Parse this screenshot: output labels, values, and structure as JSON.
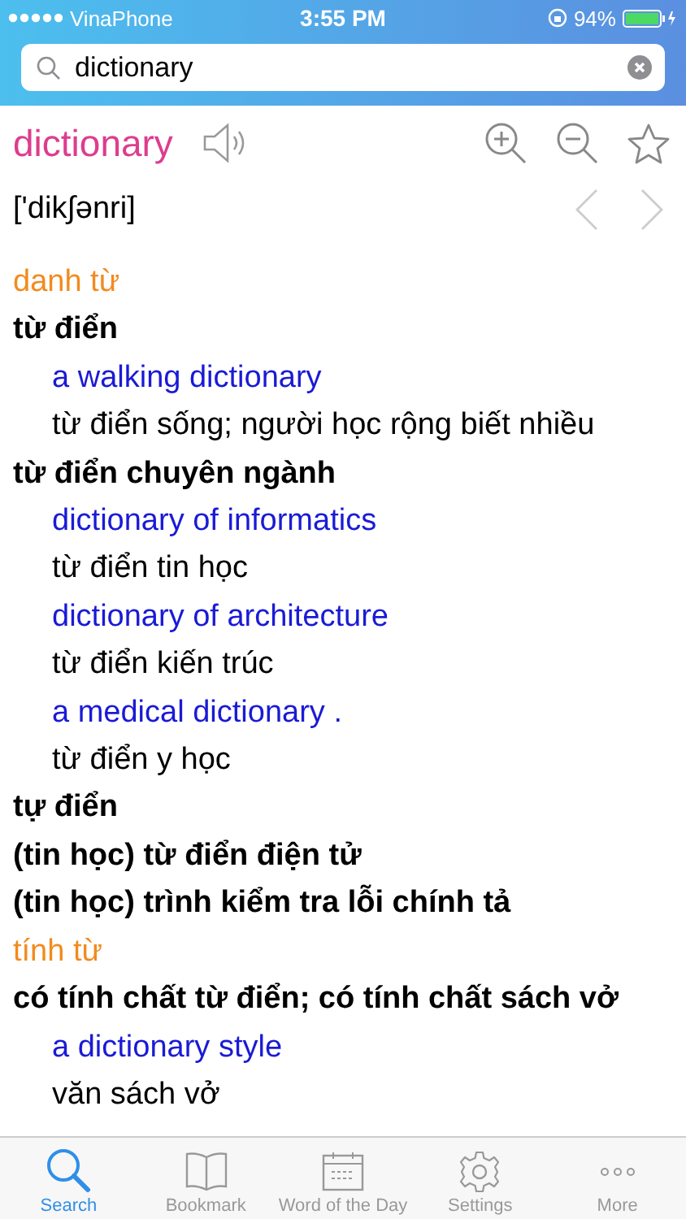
{
  "status_bar": {
    "carrier": "VinaPhone",
    "time": "3:55 PM",
    "battery": "94%"
  },
  "search": {
    "value": "dictionary"
  },
  "entry": {
    "headword": "dictionary",
    "pronunciation": "['dik∫ənri]"
  },
  "lines": [
    {
      "kind": "pos",
      "text": "danh từ"
    },
    {
      "kind": "sense",
      "text": "từ điển"
    },
    {
      "kind": "example",
      "text": "a walking dictionary"
    },
    {
      "kind": "translation",
      "text": "từ điển sống; người học rộng biết nhiều"
    },
    {
      "kind": "sense",
      "text": "từ điển chuyên ngành"
    },
    {
      "kind": "example",
      "text": "dictionary of informatics"
    },
    {
      "kind": "translation",
      "text": "từ điển tin học"
    },
    {
      "kind": "example",
      "text": "dictionary of architecture"
    },
    {
      "kind": "translation",
      "text": "từ điển kiến trúc"
    },
    {
      "kind": "example",
      "text": "a medical dictionary ."
    },
    {
      "kind": "translation",
      "text": "từ điển y học"
    },
    {
      "kind": "sense",
      "text": "tự điển"
    },
    {
      "kind": "sense",
      "text": "(tin học) từ điển điện tử"
    },
    {
      "kind": "sense",
      "text": "(tin học) trình kiểm tra lỗi chính tả"
    },
    {
      "kind": "pos",
      "text": "tính từ"
    },
    {
      "kind": "sense",
      "text": "có tính chất từ điển; có tính chất sách vở"
    },
    {
      "kind": "example",
      "text": "a dictionary style"
    },
    {
      "kind": "translation",
      "text": "văn sách vở"
    }
  ],
  "tabs": [
    {
      "kind": "search",
      "label": "Search",
      "selected": true
    },
    {
      "kind": "bookmark",
      "label": "Bookmark",
      "selected": false
    },
    {
      "kind": "calendar",
      "label": "Word of the Day",
      "selected": false
    },
    {
      "kind": "settings",
      "label": "Settings",
      "selected": false
    },
    {
      "kind": "more",
      "label": "More",
      "selected": false
    }
  ]
}
